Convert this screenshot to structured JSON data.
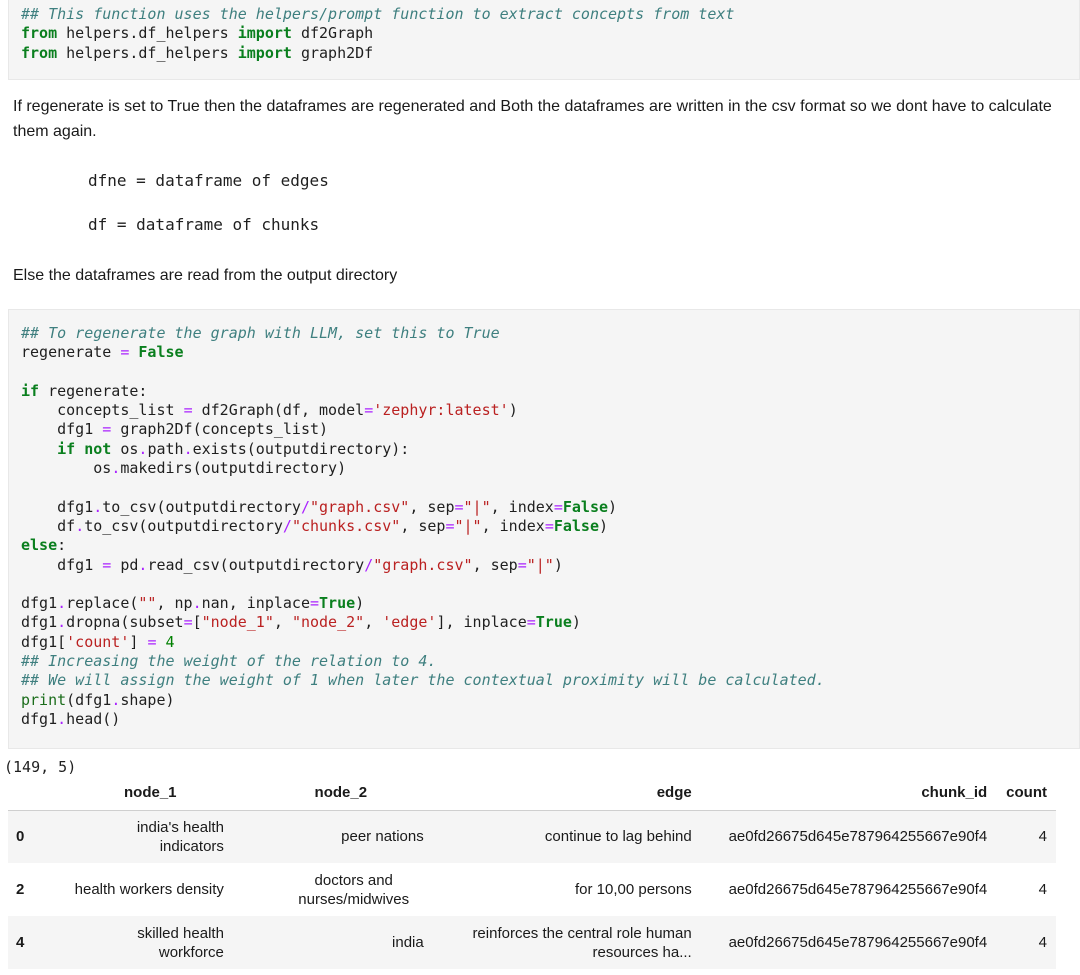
{
  "cell1": {
    "lines": [
      [
        {
          "t": "## This function uses the helpers/prompt function to extract concepts from text",
          "c": "cm"
        }
      ],
      [
        {
          "t": "from",
          "c": "kw"
        },
        {
          "t": " helpers.df_helpers "
        },
        {
          "t": "import",
          "c": "kw"
        },
        {
          "t": " df2Graph"
        }
      ],
      [
        {
          "t": "from",
          "c": "kw"
        },
        {
          "t": " helpers.df_helpers "
        },
        {
          "t": "import",
          "c": "kw"
        },
        {
          "t": " graph2Df"
        }
      ]
    ]
  },
  "markdown": {
    "paragraph1": "If regenerate is set to True then the dataframes are regenerated and Both the dataframes are written in the csv format so we dont have to calculate them again.",
    "code1": "dfne = dataframe of edges",
    "code2": "df = dataframe of chunks",
    "paragraph2": "Else the dataframes are read from the output directory"
  },
  "cell2": {
    "lines": [
      [
        {
          "t": "## To regenerate the graph with LLM, set this to True",
          "c": "cm"
        }
      ],
      [
        {
          "t": "regenerate "
        },
        {
          "t": "=",
          "c": "op"
        },
        {
          "t": " "
        },
        {
          "t": "False",
          "c": "kw"
        }
      ],
      [
        {
          "t": ""
        }
      ],
      [
        {
          "t": "if",
          "c": "kw"
        },
        {
          "t": " regenerate:"
        }
      ],
      [
        {
          "t": "    concepts_list "
        },
        {
          "t": "=",
          "c": "op"
        },
        {
          "t": " df2Graph(df, model"
        },
        {
          "t": "=",
          "c": "op"
        },
        {
          "t": "'zephyr:latest'",
          "c": "st"
        },
        {
          "t": ")"
        }
      ],
      [
        {
          "t": "    dfg1 "
        },
        {
          "t": "=",
          "c": "op"
        },
        {
          "t": " graph2Df(concepts_list)"
        }
      ],
      [
        {
          "t": "    "
        },
        {
          "t": "if",
          "c": "kw"
        },
        {
          "t": " "
        },
        {
          "t": "not",
          "c": "kw"
        },
        {
          "t": " os"
        },
        {
          "t": ".",
          "c": "op"
        },
        {
          "t": "path"
        },
        {
          "t": ".",
          "c": "op"
        },
        {
          "t": "exists(outputdirectory):"
        }
      ],
      [
        {
          "t": "        os"
        },
        {
          "t": ".",
          "c": "op"
        },
        {
          "t": "makedirs(outputdirectory)"
        }
      ],
      [
        {
          "t": ""
        }
      ],
      [
        {
          "t": "    dfg1"
        },
        {
          "t": ".",
          "c": "op"
        },
        {
          "t": "to_csv(outputdirectory"
        },
        {
          "t": "/",
          "c": "op"
        },
        {
          "t": "\"graph.csv\"",
          "c": "st"
        },
        {
          "t": ", sep"
        },
        {
          "t": "=",
          "c": "op"
        },
        {
          "t": "\"|\"",
          "c": "st"
        },
        {
          "t": ", index"
        },
        {
          "t": "=",
          "c": "op"
        },
        {
          "t": "False",
          "c": "kw"
        },
        {
          "t": ")"
        }
      ],
      [
        {
          "t": "    df"
        },
        {
          "t": ".",
          "c": "op"
        },
        {
          "t": "to_csv(outputdirectory"
        },
        {
          "t": "/",
          "c": "op"
        },
        {
          "t": "\"chunks.csv\"",
          "c": "st"
        },
        {
          "t": ", sep"
        },
        {
          "t": "=",
          "c": "op"
        },
        {
          "t": "\"|\"",
          "c": "st"
        },
        {
          "t": ", index"
        },
        {
          "t": "=",
          "c": "op"
        },
        {
          "t": "False",
          "c": "kw"
        },
        {
          "t": ")"
        }
      ],
      [
        {
          "t": "else",
          "c": "kw"
        },
        {
          "t": ":"
        }
      ],
      [
        {
          "t": "    dfg1 "
        },
        {
          "t": "=",
          "c": "op"
        },
        {
          "t": " pd"
        },
        {
          "t": ".",
          "c": "op"
        },
        {
          "t": "read_csv(outputdirectory"
        },
        {
          "t": "/",
          "c": "op"
        },
        {
          "t": "\"graph.csv\"",
          "c": "st"
        },
        {
          "t": ", sep"
        },
        {
          "t": "=",
          "c": "op"
        },
        {
          "t": "\"|\"",
          "c": "st"
        },
        {
          "t": ")"
        }
      ],
      [
        {
          "t": ""
        }
      ],
      [
        {
          "t": "dfg1"
        },
        {
          "t": ".",
          "c": "op"
        },
        {
          "t": "replace("
        },
        {
          "t": "\"\"",
          "c": "st"
        },
        {
          "t": ", np"
        },
        {
          "t": ".",
          "c": "op"
        },
        {
          "t": "nan, inplace"
        },
        {
          "t": "=",
          "c": "op"
        },
        {
          "t": "True",
          "c": "kw"
        },
        {
          "t": ")"
        }
      ],
      [
        {
          "t": "dfg1"
        },
        {
          "t": ".",
          "c": "op"
        },
        {
          "t": "dropna(subset"
        },
        {
          "t": "=",
          "c": "op"
        },
        {
          "t": "[",
          "c": ""
        },
        {
          "t": "\"node_1\"",
          "c": "st"
        },
        {
          "t": ", "
        },
        {
          "t": "\"node_2\"",
          "c": "st"
        },
        {
          "t": ", "
        },
        {
          "t": "'edge'",
          "c": "st"
        },
        {
          "t": "], inplace"
        },
        {
          "t": "=",
          "c": "op"
        },
        {
          "t": "True",
          "c": "kw"
        },
        {
          "t": ")"
        }
      ],
      [
        {
          "t": "dfg1["
        },
        {
          "t": "'count'",
          "c": "st"
        },
        {
          "t": "] "
        },
        {
          "t": "=",
          "c": "op"
        },
        {
          "t": " "
        },
        {
          "t": "4",
          "c": "nm"
        }
      ],
      [
        {
          "t": "## Increasing the weight of the relation to 4.",
          "c": "cm"
        }
      ],
      [
        {
          "t": "## We will assign the weight of 1 when later the contextual proximity will be calculated.",
          "c": "cm"
        }
      ],
      [
        {
          "t": "print",
          "c": "bi"
        },
        {
          "t": "(dfg1"
        },
        {
          "t": ".",
          "c": "op"
        },
        {
          "t": "shape)"
        }
      ],
      [
        {
          "t": "dfg1"
        },
        {
          "t": ".",
          "c": "op"
        },
        {
          "t": "head()"
        }
      ]
    ]
  },
  "output": {
    "shape": "(149, 5)",
    "table": {
      "columns": [
        "",
        "node_1",
        "node_2",
        "edge",
        "chunk_id",
        "count"
      ],
      "rows": [
        [
          "0",
          "india's health indicators",
          "peer nations",
          "continue to lag behind",
          "ae0fd26675d645e787964255667e90f4",
          "4"
        ],
        [
          "2",
          "health workers density",
          "doctors and nurses/midwives",
          "for 10,00 persons",
          "ae0fd26675d645e787964255667e90f4",
          "4"
        ],
        [
          "4",
          "skilled health workforce",
          "india",
          "reinforces the central role human resources ha...",
          "ae0fd26675d645e787964255667e90f4",
          "4"
        ]
      ]
    }
  }
}
